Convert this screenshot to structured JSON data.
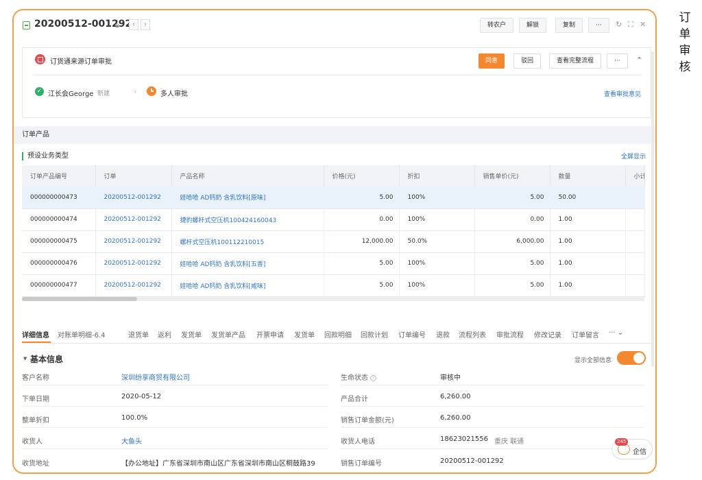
{
  "side_title": "订单审核",
  "header": {
    "title": "20200512-001292",
    "prev": "‹",
    "next": "›",
    "buttons": [
      "转农户",
      "解锁",
      "复制",
      "···"
    ],
    "icons": [
      "↻",
      "⛶",
      "✕"
    ]
  },
  "approval": {
    "title": "订货通来源订单审批",
    "buttons": {
      "agree": "同意",
      "reject": "驳回",
      "full_flow": "查看完整流程",
      "more": "···",
      "collapse": "⌃"
    },
    "step1": {
      "name": "江长会George",
      "status": "新建"
    },
    "step2": {
      "name": "多人审批"
    },
    "view_opinions": "查看审批意见"
  },
  "products": {
    "section_title": "订单产品",
    "sub_title": "预设业务类型",
    "fullscreen": "全屏显示",
    "columns": [
      "订单产品编号",
      "订单",
      "产品名称",
      "价格(元)",
      "折扣",
      "销售单价(元)",
      "数量",
      "小计"
    ],
    "rows": [
      {
        "code": "000000000473",
        "order": "20200512-001292",
        "name": "娃哈哈 AD钙奶 含乳饮料[原味]",
        "price": "5.00",
        "discount": "100%",
        "unit_price": "5.00",
        "qty": "50.00"
      },
      {
        "code": "000000000474",
        "order": "20200512-001292",
        "name": "捷豹螺杆式空压机100424160043",
        "price": "0.00",
        "discount": "100%",
        "unit_price": "0.00",
        "qty": "1.00"
      },
      {
        "code": "000000000475",
        "order": "20200512-001292",
        "name": "螺杆式空压机100112210015",
        "price": "12,000.00",
        "discount": "50.0%",
        "unit_price": "6,000.00",
        "qty": "1.00"
      },
      {
        "code": "000000000476",
        "order": "20200512-001292",
        "name": "娃哈哈 AD钙奶 含乳饮料[五香]",
        "price": "5.00",
        "discount": "100%",
        "unit_price": "5.00",
        "qty": "1.00"
      },
      {
        "code": "000000000477",
        "order": "20200512-001292",
        "name": "娃哈哈 AD钙奶 含乳饮料[咸味]",
        "price": "5.00",
        "discount": "100%",
        "unit_price": "5.00",
        "qty": "1.00"
      }
    ]
  },
  "tabs": [
    "详细信息",
    "对账单明细-6.4",
    "退货单",
    "返利",
    "发货单",
    "发货单产品",
    "开票申请",
    "发货单",
    "回款明细",
    "回款计划",
    "订单编号",
    "退款",
    "流程列表",
    "审批流程",
    "修改记录",
    "订单留言",
    "··· ⌄"
  ],
  "basic_info": {
    "title": "基本信息",
    "show_all": "显示全部信息",
    "left": [
      {
        "label": "客户名称",
        "value": "深圳纷享商贸有限公司"
      },
      {
        "label": "下单日期",
        "value": "2020-05-12"
      },
      {
        "label": "整单折扣",
        "value": "100.0%"
      },
      {
        "label": "收货人",
        "value": "大鱼头"
      },
      {
        "label": "收货地址",
        "value": "【办公地址】广东省深圳市南山区广东省深圳市南山区桐鼓路39"
      }
    ],
    "right": [
      {
        "label": "生命状态",
        "value": "审核中"
      },
      {
        "label": "产品合计",
        "value": "6,260.00"
      },
      {
        "label": "销售订单金额(元)",
        "value": "6,260.00"
      },
      {
        "label": "收货人电话",
        "value": "18623021556",
        "extra": "重庆 联通"
      },
      {
        "label": "销售订单编号",
        "value": "20200512-001292"
      }
    ]
  },
  "chat": {
    "count": "245",
    "label": "企信"
  }
}
